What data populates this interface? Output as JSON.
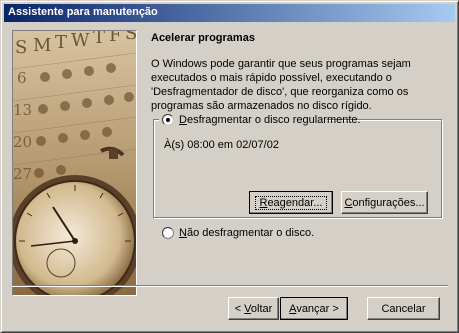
{
  "window": {
    "title": "Assistente para manutenção"
  },
  "page": {
    "heading": "Acelerar programas",
    "description": "O Windows pode garantir que seus programas sejam executados o mais rápido possível, executando o 'Desfragmentador de disco', que reorganiza como os programas são armazenados no disco rígido."
  },
  "options": {
    "defrag_radio_label": "Desfragmentar o disco regularmente.",
    "defrag_selected": true,
    "schedule_text": "À(s) 08:00 em 02/07/02",
    "reschedule_button": "Reagendar...",
    "settings_button": "Configurações...",
    "no_defrag_radio_label": "Não desfragmentar o disco.",
    "no_defrag_selected": false
  },
  "illustration": {
    "calendar_letters": [
      "S",
      "M",
      "T",
      "W",
      "T",
      "F",
      "S"
    ],
    "calendar_numbers": [
      "6",
      "13",
      "20",
      "27"
    ]
  },
  "footer": {
    "back_button": "< Voltar",
    "next_button": "Avançar >",
    "cancel_button": "Cancelar"
  },
  "colors": {
    "titlebar_start": "#0a246a",
    "titlebar_end": "#a6caf0",
    "face": "#d4d0c8",
    "illustration_tone": "#a08258"
  }
}
